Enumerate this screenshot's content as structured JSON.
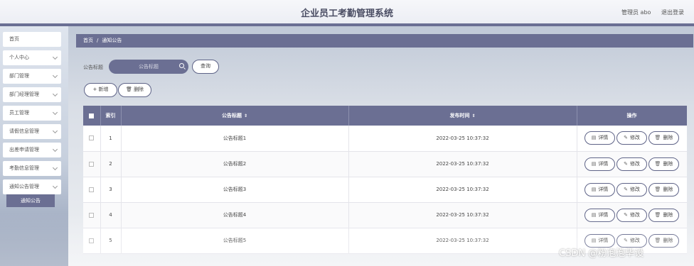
{
  "header": {
    "title": "企业员工考勤管理系统",
    "user": "管理员 abo",
    "logout": "退出登录"
  },
  "sidebar": {
    "items": [
      {
        "label": "首页"
      },
      {
        "label": "个人中心"
      },
      {
        "label": "部门管理"
      },
      {
        "label": "部门经理管理"
      },
      {
        "label": "员工管理"
      },
      {
        "label": "请假信息管理"
      },
      {
        "label": "出差申请管理"
      },
      {
        "label": "考勤信息管理"
      },
      {
        "label": "通知公告管理"
      }
    ],
    "active_sub": "通知公告"
  },
  "breadcrumb": {
    "home": "首页",
    "separator": "/",
    "current": "通知公告"
  },
  "search": {
    "label": "公告标题",
    "placeholder": "公告标题",
    "query_button": "查询"
  },
  "toolbar": {
    "add_button": "+ 新增",
    "delete_button": "删除"
  },
  "table": {
    "columns": [
      "",
      "索引",
      "公告标题",
      "发布时间",
      "操作"
    ],
    "rows": [
      {
        "index": "1",
        "title": "公告标题1",
        "time": "2022-03-25 10:37:32"
      },
      {
        "index": "2",
        "title": "公告标题2",
        "time": "2022-03-25 10:37:32"
      },
      {
        "index": "3",
        "title": "公告标题3",
        "time": "2022-03-25 10:37:32"
      },
      {
        "index": "4",
        "title": "公告标题4",
        "time": "2022-03-25 10:37:32"
      },
      {
        "index": "5",
        "title": "公告标题5",
        "time": "2022-03-25 10:37:32"
      }
    ],
    "actions": {
      "detail": "详情",
      "edit": "修改",
      "delete": "删除"
    }
  },
  "watermark": "CSDN @粉泡泡毕设",
  "colors": {
    "accent": "#6b6f93",
    "border": "#5e6387"
  },
  "icons": [
    "search-icon",
    "plus-icon",
    "trash-icon",
    "document-icon",
    "pencil-icon",
    "chevron-down-icon",
    "sort-icon"
  ]
}
